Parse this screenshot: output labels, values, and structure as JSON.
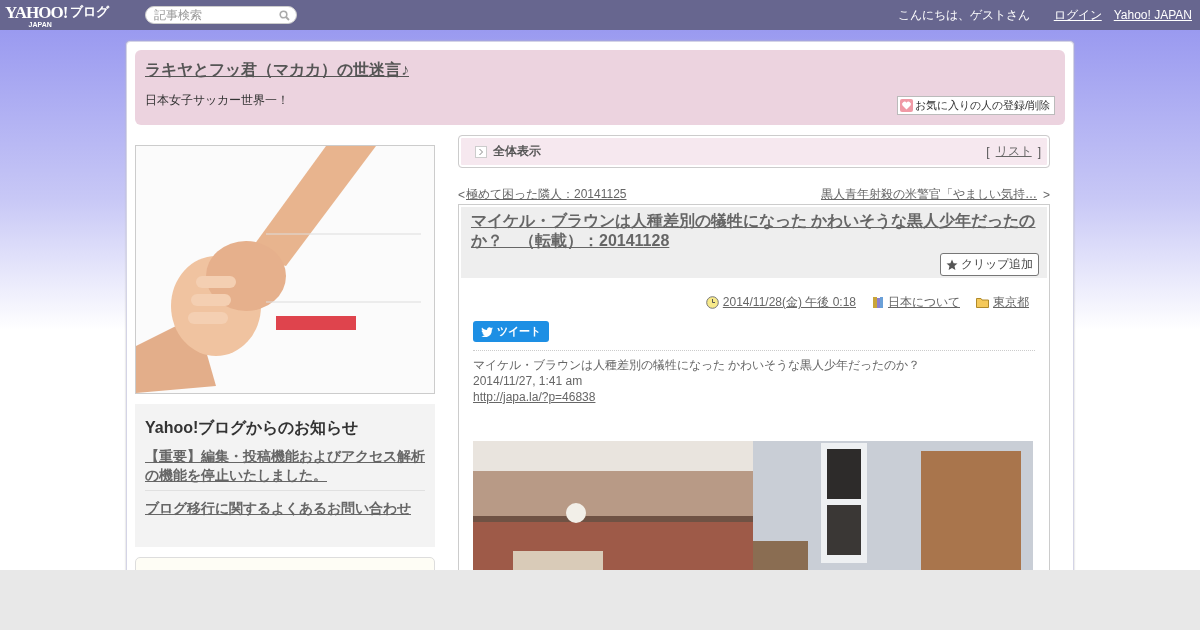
{
  "top_bar": {
    "logo": "YAHOO!",
    "logo_sub": "JAPAN",
    "logo_service": "ブログ",
    "search": {
      "placeholder": "記事検索"
    },
    "greeting": "こんにちは、ゲストさん",
    "links": [
      "ログイン",
      "Yahoo! JAPAN"
    ]
  },
  "blog_header": {
    "title": "ラキヤとフッ君（マカカ）の世迷言♪",
    "description": "日本女子サッカー世界一！",
    "favorite_button": "お気に入りの人の登録/削除"
  },
  "sidebar": {
    "notice": {
      "title": "Yahoo!ブログからのお知らせ",
      "links": [
        "【重要】編集・投稿機能およびアクセス解析の機能を停止いたしました。",
        "ブログ移行に関するよくあるお問い合わせ"
      ]
    }
  },
  "view_bar": {
    "label": "全体表示",
    "list_link": "リスト",
    "bracket_open": "[",
    "bracket_close": "]"
  },
  "nav": {
    "prev_mark": "<",
    "prev": "極めて困った隣人：20141125",
    "next": "黒人青年射殺の米警官「やましい気持…",
    "next_mark": ">"
  },
  "article": {
    "title": "マイケル・ブラウンは人種差別の犠牲になった かわいそうな黒人少年だったのか？　（転載）：20141128",
    "clip_button": "クリップ追加",
    "date": "2014/11/28(金) 午後 0:18",
    "category": "日本について",
    "location": "東京都",
    "tweet_button": "ツイート",
    "body": [
      "マイケル・ブラウンは人種差別の犠牲になった かわいそうな黒人少年だったのか？",
      "2014/11/27, 1:41 am"
    ],
    "link": "http://japa.la/?p=46838"
  }
}
